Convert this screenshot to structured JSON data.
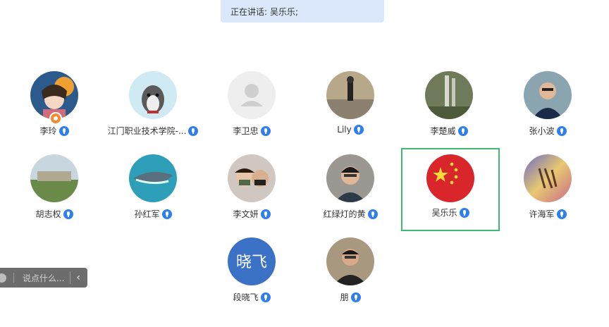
{
  "speaking": {
    "label": "正在讲话:",
    "names": "吴乐乐;"
  },
  "participants": [
    {
      "name": "李玲",
      "host": true,
      "active": false
    },
    {
      "name": "江门职业技术学院-...",
      "host": false,
      "active": false
    },
    {
      "name": "李卫忠",
      "host": false,
      "active": false
    },
    {
      "name": "Lily",
      "host": false,
      "active": false
    },
    {
      "name": "李楚威",
      "host": false,
      "active": false
    },
    {
      "name": "张小波",
      "host": false,
      "active": false
    },
    {
      "name": "胡志权",
      "host": false,
      "active": false
    },
    {
      "name": "孙红军",
      "host": false,
      "active": false
    },
    {
      "name": "李文妍",
      "host": false,
      "active": false
    },
    {
      "name": "红绿灯的黄",
      "host": false,
      "active": false
    },
    {
      "name": "吴乐乐",
      "host": false,
      "active": true
    },
    {
      "name": "许海军",
      "host": false,
      "active": false
    },
    {
      "name": "段晓飞",
      "host": false,
      "active": false,
      "avatar_text": "晓飞"
    },
    {
      "name": "朋",
      "host": false,
      "active": false
    }
  ],
  "chat": {
    "placeholder": "说点什么..."
  },
  "colors": {
    "active_border": "#3dbb73",
    "mic": "#2f7ff0",
    "host_badge": "#f58a32",
    "speaking_bg": "#dbe8fb"
  }
}
